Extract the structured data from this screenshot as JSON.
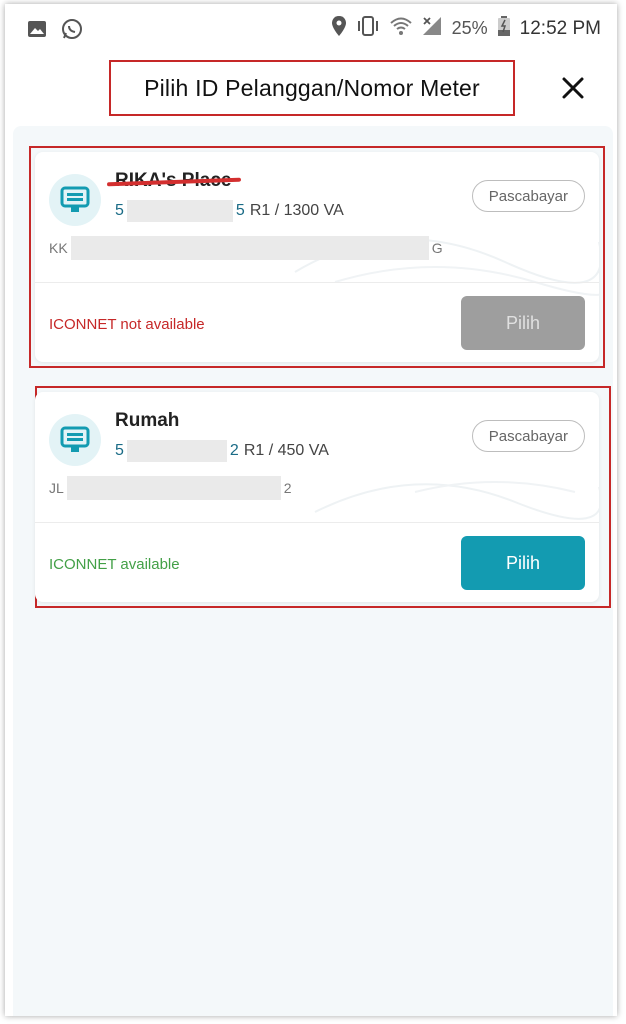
{
  "status_bar": {
    "left_icons": [
      "image-icon",
      "whatsapp-icon"
    ],
    "right_icons": [
      "location-icon",
      "vibrate-icon",
      "wifi-icon",
      "signal-icon",
      "battery-icon"
    ],
    "battery": "25%",
    "time": "12:52 PM"
  },
  "header": {
    "title": "Pilih ID Pelanggan/Nomor Meter",
    "close_icon": "close-icon"
  },
  "cards": [
    {
      "name": "RIKA's Place",
      "name_struck": true,
      "id_start": "5",
      "id_end": "5",
      "tariff": "R1 / 1300 VA",
      "badge": "Pascabayar",
      "addr_start": "KK",
      "addr_end": "G",
      "status": "ICONNET not available",
      "button": "Pilih",
      "button_enabled": false
    },
    {
      "name": "Rumah",
      "name_struck": false,
      "id_start": "5",
      "id_end": "2",
      "tariff": "R1 / 450 VA",
      "badge": "Pascabayar",
      "addr_start": "JL",
      "addr_end": "2",
      "status": "ICONNET available",
      "button": "Pilih",
      "button_enabled": true
    }
  ],
  "colors": {
    "annotation": "#c62828",
    "primary": "#139bb1",
    "available": "#43a047",
    "unavailable": "#c62828",
    "disabled": "#9e9e9e"
  }
}
